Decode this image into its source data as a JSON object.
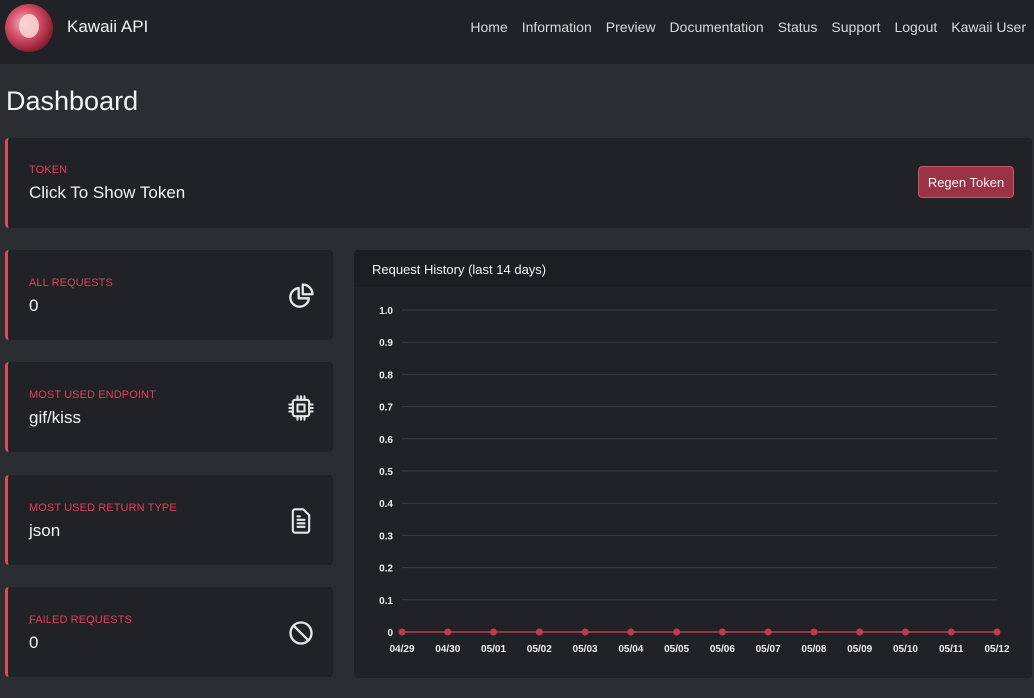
{
  "app": {
    "brand": "Kawaii API"
  },
  "nav": [
    "Home",
    "Information",
    "Preview",
    "Documentation",
    "Status",
    "Support",
    "Logout",
    "Kawaii User"
  ],
  "page": {
    "title": "Dashboard"
  },
  "token": {
    "label": "TOKEN",
    "value": "Click To Show Token",
    "button": "Regen Token"
  },
  "stats": [
    {
      "label": "ALL REQUESTS",
      "value": "0",
      "icon": "pie-chart-icon"
    },
    {
      "label": "MOST USED ENDPOINT",
      "value": "gif/kiss",
      "icon": "cpu-icon"
    },
    {
      "label": "MOST USED RETURN TYPE",
      "value": "json",
      "icon": "document-icon"
    },
    {
      "label": "FAILED REQUESTS",
      "value": "0",
      "icon": "ban-icon"
    }
  ],
  "colors": {
    "accent": "#e0405b",
    "button": "#9b3245",
    "background": "#2b2d31",
    "card": "#202226"
  },
  "chart_title": "Request History (last 14 days)",
  "chart_data": {
    "type": "line",
    "categories": [
      "04/29",
      "04/30",
      "05/01",
      "05/02",
      "05/03",
      "05/04",
      "05/05",
      "05/06",
      "05/07",
      "05/08",
      "05/09",
      "05/10",
      "05/11",
      "05/12"
    ],
    "series": [
      {
        "values": [
          0,
          0,
          0,
          0,
          0,
          0,
          0,
          0,
          0,
          0,
          0,
          0,
          0,
          0
        ]
      }
    ],
    "yticks": [
      "0",
      "0.1",
      "0.2",
      "0.3",
      "0.4",
      "0.5",
      "0.6",
      "0.7",
      "0.8",
      "0.9",
      "1.0"
    ],
    "ylim": [
      0,
      1
    ],
    "grid": true,
    "line_color": "#c0394f",
    "title": "",
    "xlabel": "",
    "ylabel": ""
  }
}
